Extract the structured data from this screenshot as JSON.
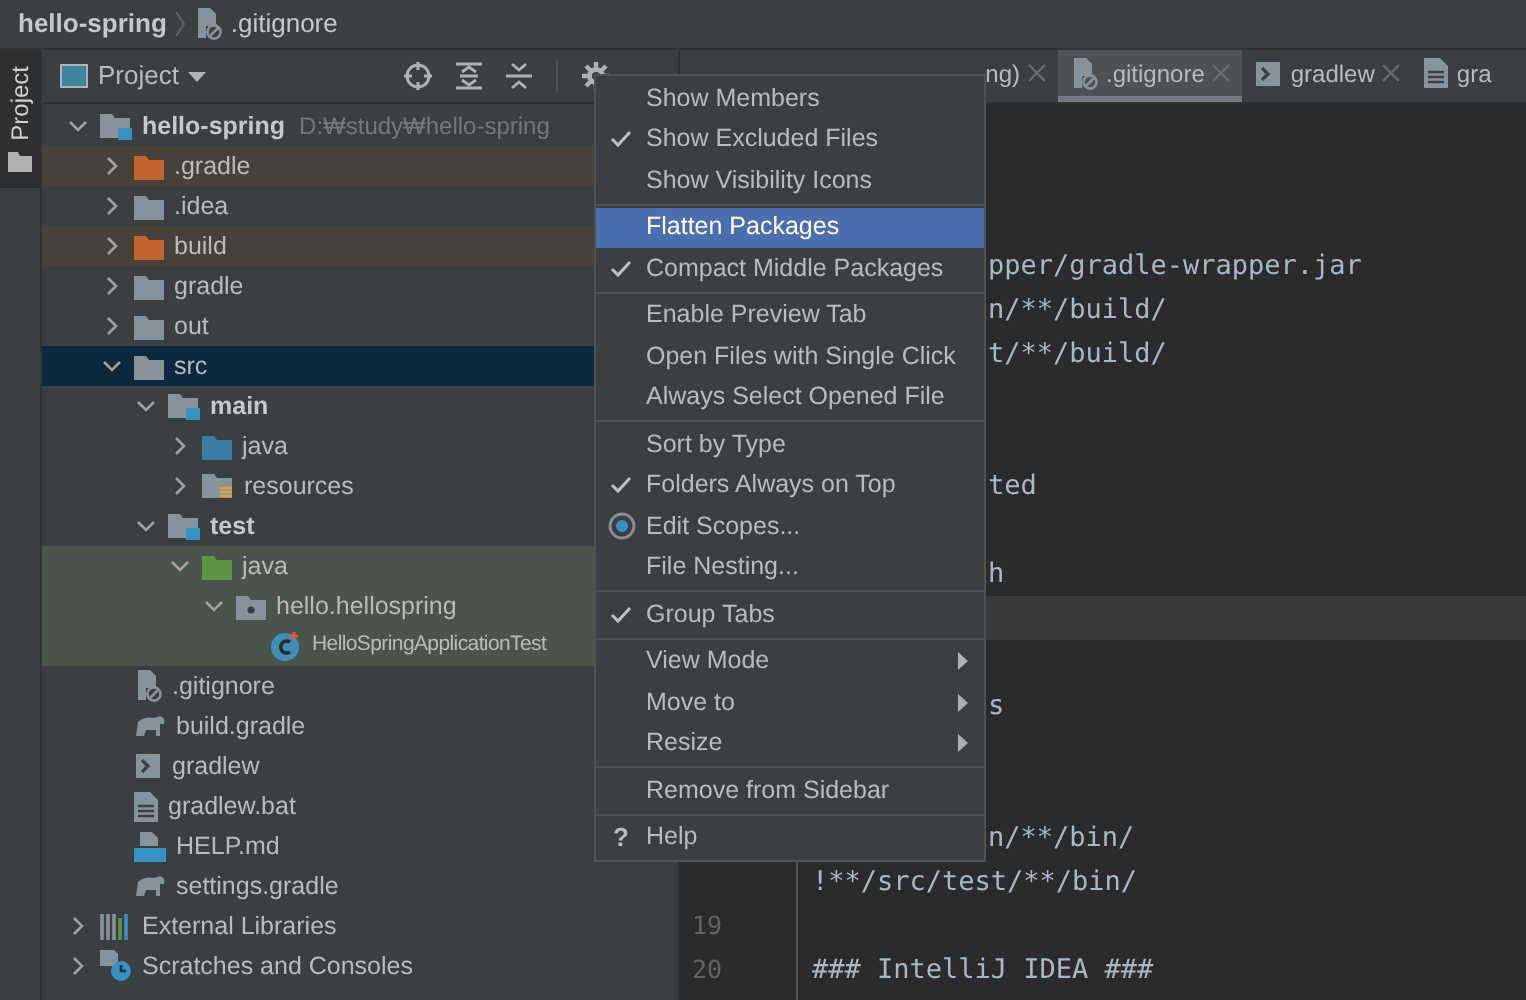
{
  "breadcrumb": {
    "project": "hello-spring",
    "file": ".gitignore"
  },
  "tool_strip": {
    "label": "Project",
    "selected": true
  },
  "project_panel": {
    "title": "Project",
    "tree": [
      {
        "label": "hello-spring",
        "path": "D:₩study₩hello-spring",
        "kind": "module",
        "expanded": true,
        "selected": false,
        "children": [
          {
            "label": ".gradle",
            "kind": "excluded",
            "expanded": false,
            "selected": false
          },
          {
            "label": ".idea",
            "kind": "folder",
            "expanded": false,
            "selected": false
          },
          {
            "label": "build",
            "kind": "excluded",
            "expanded": false,
            "selected": false
          },
          {
            "label": "gradle",
            "kind": "folder",
            "expanded": false,
            "selected": false
          },
          {
            "label": "out",
            "kind": "folder",
            "expanded": false,
            "selected": false
          },
          {
            "label": "src",
            "kind": "folder",
            "expanded": true,
            "selected": true,
            "children": [
              {
                "label": "main",
                "kind": "module",
                "expanded": true,
                "selected": false,
                "children": [
                  {
                    "label": "java",
                    "kind": "source",
                    "expanded": false,
                    "selected": false
                  },
                  {
                    "label": "resources",
                    "kind": "resources",
                    "expanded": false,
                    "selected": false
                  }
                ]
              },
              {
                "label": "test",
                "kind": "module",
                "expanded": true,
                "selected": false,
                "children": [
                  {
                    "label": "java",
                    "kind": "test-source",
                    "expanded": true,
                    "selected": false,
                    "children": [
                      {
                        "label": "hello.hellospring",
                        "kind": "package",
                        "expanded": true,
                        "selected": false,
                        "children": [
                          {
                            "label": "HelloSpringApplicationTest",
                            "kind": "test-class",
                            "selected": false
                          }
                        ]
                      }
                    ]
                  }
                ]
              }
            ]
          },
          {
            "label": ".gitignore",
            "kind": "gitignore",
            "selected": false
          },
          {
            "label": "build.gradle",
            "kind": "gradle",
            "selected": false
          },
          {
            "label": "gradlew",
            "kind": "terminal",
            "selected": false
          },
          {
            "label": "gradlew.bat",
            "kind": "text",
            "selected": false
          },
          {
            "label": "HELP.md",
            "kind": "markdown",
            "selected": false
          },
          {
            "label": "settings.gradle",
            "kind": "gradle",
            "selected": false
          }
        ]
      },
      {
        "label": "External Libraries",
        "kind": "libraries",
        "expanded": false,
        "selected": false
      },
      {
        "label": "Scratches and Consoles",
        "kind": "scratches",
        "expanded": false,
        "selected": false
      }
    ]
  },
  "editor": {
    "tabs": [
      {
        "label": "ng)",
        "kind": "plain",
        "selected": false
      },
      {
        "label": ".gitignore",
        "kind": "gitignore",
        "selected": true
      },
      {
        "label": "gradlew",
        "kind": "terminal",
        "selected": false
      },
      {
        "label": "gra",
        "kind": "text",
        "selected": false
      }
    ],
    "lines": [
      {
        "kind": "covered",
        "current": false
      },
      {
        "kind": "covered",
        "current": false
      },
      {
        "kind": "covered",
        "current": false
      },
      {
        "kind": "covered",
        "text": "pper/gradle-wrapper.jar",
        "current": false
      },
      {
        "kind": "covered",
        "text": "n/**/build/",
        "current": false
      },
      {
        "kind": "covered",
        "text": "t/**/build/",
        "current": false
      },
      {
        "kind": "covered",
        "current": false
      },
      {
        "kind": "covered",
        "current": false
      },
      {
        "kind": "covered",
        "text": "ted",
        "current": false
      },
      {
        "kind": "covered",
        "current": false
      },
      {
        "kind": "covered",
        "text": "h",
        "current": false
      },
      {
        "kind": "covered",
        "current": true
      },
      {
        "kind": "covered",
        "current": false
      },
      {
        "kind": "covered",
        "text": "s",
        "current": false
      },
      {
        "kind": "covered",
        "current": false
      },
      {
        "kind": "covered",
        "current": false
      },
      {
        "kind": "covered",
        "text": "n/**/bin/",
        "current": false
      },
      {
        "kind": "full",
        "text": "!**/src/test/**/bin/",
        "current": false
      },
      {
        "kind": "full",
        "number": "19",
        "current": false
      },
      {
        "kind": "full",
        "number": "20",
        "text": "### IntelliJ IDEA ###",
        "current": false
      }
    ]
  },
  "context_menu": {
    "groups": [
      [
        {
          "kind": "toggle",
          "label": "Show Members",
          "checked": false,
          "selected": false
        },
        {
          "kind": "toggle",
          "label": "Show Excluded Files",
          "checked": true,
          "selected": false
        },
        {
          "kind": "toggle",
          "label": "Show Visibility Icons",
          "checked": false,
          "selected": false
        }
      ],
      [
        {
          "kind": "toggle",
          "label": "Flatten Packages",
          "checked": false,
          "selected": true
        },
        {
          "kind": "toggle",
          "label": "Compact Middle Packages",
          "checked": true,
          "selected": false
        }
      ],
      [
        {
          "kind": "toggle",
          "label": "Enable Preview Tab",
          "checked": false,
          "selected": false
        },
        {
          "kind": "toggle",
          "label": "Open Files with Single Click",
          "checked": false,
          "selected": false
        },
        {
          "kind": "toggle",
          "label": "Always Select Opened File",
          "checked": false,
          "selected": false
        }
      ],
      [
        {
          "kind": "toggle",
          "label": "Sort by Type",
          "checked": false,
          "selected": false
        },
        {
          "kind": "toggle",
          "label": "Folders Always on Top",
          "checked": true,
          "selected": false
        },
        {
          "kind": "radio",
          "label": "Edit Scopes...",
          "checked": true,
          "selected": false
        },
        {
          "kind": "action",
          "label": "File Nesting...",
          "selected": false
        }
      ],
      [
        {
          "kind": "toggle",
          "label": "Group Tabs",
          "checked": true,
          "selected": false
        }
      ],
      [
        {
          "kind": "submenu",
          "label": "View Mode",
          "selected": false
        },
        {
          "kind": "submenu",
          "label": "Move to",
          "selected": false
        },
        {
          "kind": "submenu",
          "label": "Resize",
          "selected": false
        }
      ],
      [
        {
          "kind": "action",
          "label": "Remove from Sidebar",
          "selected": false
        }
      ],
      [
        {
          "kind": "help",
          "glyph": "?",
          "label": "Help",
          "selected": false
        }
      ]
    ]
  }
}
